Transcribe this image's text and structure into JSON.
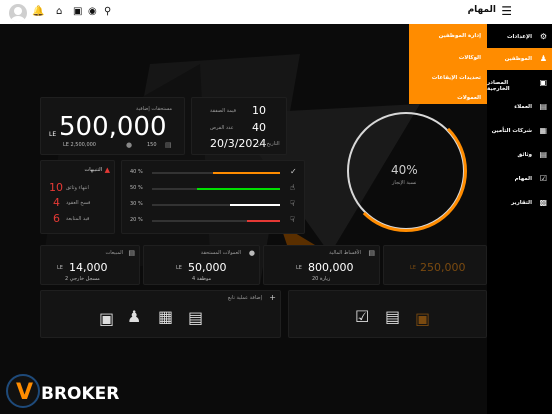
{
  "topbar": {
    "title": "المهام",
    "menu_icon": "hamburger-icon",
    "icons": [
      "bell-icon",
      "home-icon",
      "save-icon",
      "globe-icon",
      "search-icon"
    ]
  },
  "colors": {
    "accent": "#ff8c00",
    "green": "#00e000",
    "red": "#e53935",
    "background": "#0b0b0b"
  },
  "sidebar": {
    "items": [
      {
        "label": "الإعدادات",
        "icon": "gear-icon"
      },
      {
        "label": "الموظفين",
        "icon": "users-icon"
      },
      {
        "label": "المصادر الخارجية",
        "icon": "inbox-icon"
      },
      {
        "label": "العملاء",
        "icon": "folder-user-icon"
      },
      {
        "label": "شركات التأمين",
        "icon": "building-icon"
      },
      {
        "label": "وثائق",
        "icon": "clipboard-icon"
      },
      {
        "label": "المهام",
        "icon": "calendar-check-icon"
      },
      {
        "label": "التقارير",
        "icon": "chart-icon"
      }
    ],
    "active_index": 1
  },
  "submenu": {
    "items": [
      "إدارة الموظفين",
      "الوكالات",
      "تحديدات الإيقاعات",
      "العمولات"
    ]
  },
  "revenue": {
    "label": "مستحقات إضافية",
    "amount": "500,000",
    "currency": "LE",
    "sub_amount": "LE 2,500,000",
    "sub_count": "150"
  },
  "stats": {
    "row1_value": "10",
    "row1_label": "قيمة الصفقة",
    "row2_value": "40",
    "row2_label": "عدد الفرص",
    "date": "20/3/2024",
    "date_label": "التاريخ إلى"
  },
  "donut": {
    "value": "40%",
    "label": "نسبة الإنجاز"
  },
  "alerts": {
    "title": "التنبيهات",
    "items": [
      {
        "value": "10",
        "label": "انتهاء وثائق"
      },
      {
        "value": "4",
        "label": "فسخ العقود"
      },
      {
        "value": "6",
        "label": "قيد المتابعة"
      }
    ]
  },
  "progress": [
    {
      "label": "40 %",
      "fraction": 0.4,
      "color": "#ff8c00",
      "icon": "check-icon"
    },
    {
      "label": "50 %",
      "fraction": 0.5,
      "color": "#00e000",
      "icon": "thumbs-up-icon"
    },
    {
      "label": "30 %",
      "fraction": 0.3,
      "color": "#ffffff",
      "icon": "thumbs-down-icon"
    },
    {
      "label": "20 %",
      "fraction": 0.2,
      "color": "#e53935",
      "icon": "thumbs-down-icon"
    }
  ],
  "summary_cards": [
    {
      "title": "المبيعات",
      "amount": "14,000",
      "currency": "LE",
      "sub": "2 مسجل خارجي"
    },
    {
      "title": "العمولات المستحقة",
      "amount": "50,000",
      "currency": "LE",
      "sub": "4 موظفة"
    },
    {
      "title": "الأقساط المالية",
      "amount": "800,000",
      "currency": "LE",
      "sub": "20 زيارة"
    },
    {
      "title": "",
      "amount": "250,000",
      "currency": "LE",
      "sub": ""
    }
  ],
  "quick_actions": {
    "title": "إضافة عملية تابع",
    "icons": [
      "inbox-icon",
      "users-icon",
      "building-icon",
      "folder-user-icon",
      "calendar-check-icon",
      "clipboard-icon",
      "inbox-icon"
    ]
  },
  "brand": {
    "logo_text": "BROKER",
    "logo_letter": "V"
  }
}
